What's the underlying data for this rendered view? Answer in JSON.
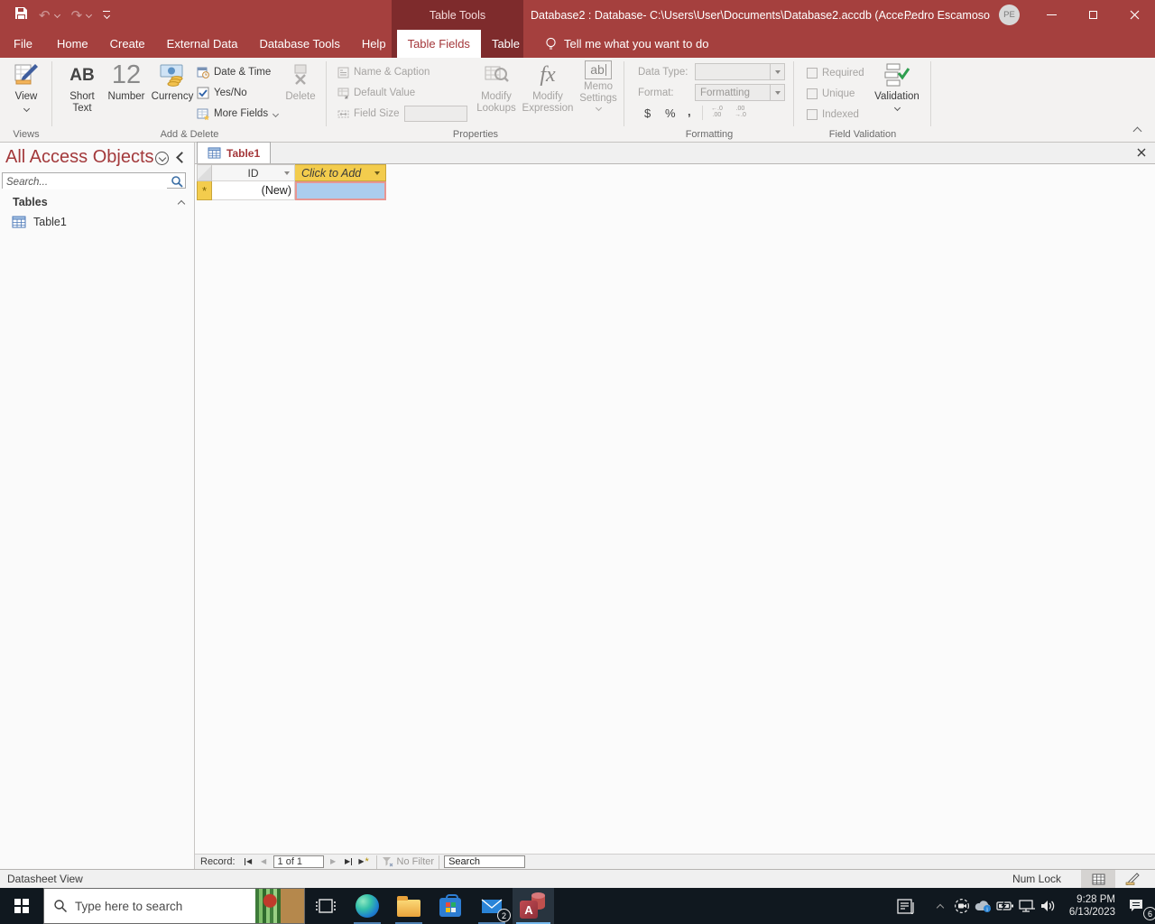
{
  "titlebar": {
    "contextual_group": "Table Tools",
    "title": "Database2 : Database- C:\\Users\\User\\Documents\\Database2.accdb (Acce...",
    "user_name": "Pedro Escamoso",
    "user_initials": "PE"
  },
  "tabs": [
    {
      "label": "File"
    },
    {
      "label": "Home"
    },
    {
      "label": "Create"
    },
    {
      "label": "External Data"
    },
    {
      "label": "Database Tools"
    },
    {
      "label": "Help"
    },
    {
      "label": "Table Fields"
    },
    {
      "label": "Table"
    }
  ],
  "tell_me": "Tell me what you want to do",
  "ribbon": {
    "views": {
      "group_label": "Views",
      "view": "View"
    },
    "add_delete": {
      "group_label": "Add & Delete",
      "short_text_icon": "AB",
      "short_text": "Short Text",
      "number_icon": "12",
      "number": "Number",
      "currency": "Currency",
      "date_time": "Date & Time",
      "yes_no": "Yes/No",
      "more_fields": "More Fields",
      "delete": "Delete"
    },
    "properties": {
      "group_label": "Properties",
      "name_caption": "Name & Caption",
      "default_value": "Default Value",
      "field_size": "Field Size",
      "modify_lookups": "Modify Lookups",
      "fx_icon": "fx",
      "modify_expression": "Modify Expression",
      "memo_icon": "ab",
      "memo_settings": "Memo Settings"
    },
    "formatting": {
      "group_label": "Formatting",
      "data_type_label": "Data Type:",
      "format_label": "Format:",
      "format_value": "Formatting",
      "dollar": "$",
      "percent": "%",
      "comma": ",",
      "inc_decimal_top": "←.0",
      "inc_decimal_bottom": ".00",
      "dec_decimal_top": ".00",
      "dec_decimal_bottom": "→.0"
    },
    "field_validation": {
      "group_label": "Field Validation",
      "required": "Required",
      "unique": "Unique",
      "indexed": "Indexed",
      "validation": "Validation"
    }
  },
  "nav_pane": {
    "title": "All Access Objects",
    "search_placeholder": "Search...",
    "tables_group": "Tables",
    "table1": "Table1"
  },
  "datasheet": {
    "doc_tab": "Table1",
    "id_header": "ID",
    "add_header": "Click to Add",
    "new_row_marker": "*",
    "new_value": "(New)"
  },
  "record_bar": {
    "record_label": "Record:",
    "position": "1 of 1",
    "first_glyph": "◀",
    "prev_glyph": "◀",
    "next_glyph": "▶",
    "last_glyph": "▶",
    "new_glyph": "▶",
    "new_star": "*",
    "no_filter": "No Filter",
    "search_placeholder": "Search"
  },
  "status_bar": {
    "view_name": "Datasheet View",
    "num_lock": "Num Lock"
  },
  "taskbar": {
    "search_placeholder": "Type here to search",
    "mail_badge": "2",
    "access_letter": "A",
    "time": "9:28 PM",
    "date": "6/13/2023",
    "notification_badge": "6"
  },
  "colors": {
    "accent_red": "#A5403E",
    "contextual_red": "#7E2B2C",
    "amber_highlight": "#F3CC4D",
    "selection_blue": "#ABCDEE",
    "selection_border": "#E79693",
    "taskbar_underline": "#76B9ED"
  }
}
